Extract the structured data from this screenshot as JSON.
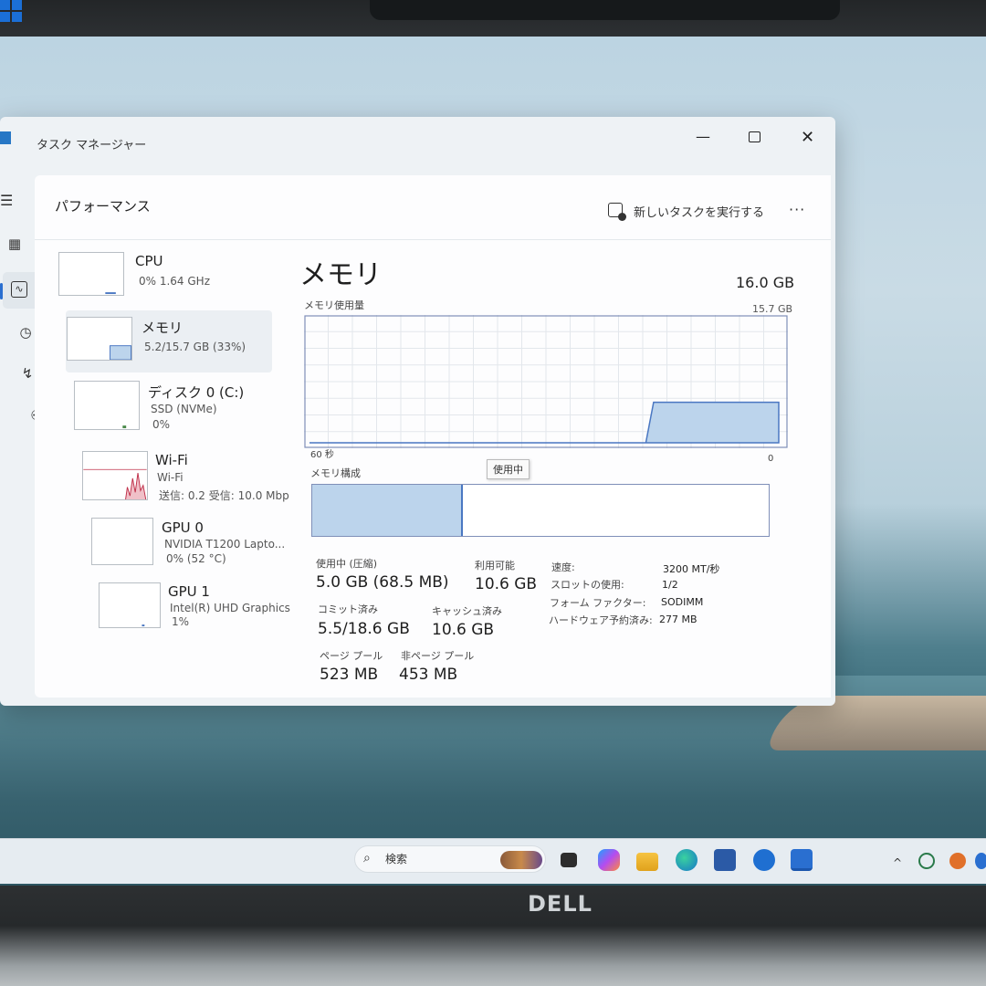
{
  "window": {
    "title": "タスク マネージャー",
    "page_title": "パフォーマンス",
    "run_task_label": "新しいタスクを実行する",
    "more_label": "···"
  },
  "nav": {
    "icons": [
      "hamburger-icon",
      "processes-icon",
      "performance-icon",
      "history-icon",
      "startup-icon",
      "users-icon",
      "details-icon",
      "services-icon",
      "settings-icon"
    ],
    "active": "performance-icon"
  },
  "devices": [
    {
      "name": "CPU",
      "sub1": "0% 1.64 GHz",
      "sub2": "",
      "sub3": ""
    },
    {
      "name": "メモリ",
      "sub1": "5.2/15.7 GB (33%)",
      "sub2": "",
      "sub3": ""
    },
    {
      "name": "ディスク 0 (C:)",
      "sub1": "SSD (NVMe)",
      "sub2": "0%",
      "sub3": ""
    },
    {
      "name": "Wi-Fi",
      "sub1": "Wi-Fi",
      "sub2": "送信: 0.2 受信: 10.0 Mbp",
      "sub3": ""
    },
    {
      "name": "GPU 0",
      "sub1": "NVIDIA T1200 Lapto...",
      "sub2": "0% (52 °C)",
      "sub3": ""
    },
    {
      "name": "GPU 1",
      "sub1": "Intel(R) UHD Graphics",
      "sub2": "1%",
      "sub3": ""
    }
  ],
  "memory": {
    "title": "メモリ",
    "total": "16.0 GB",
    "usage_label": "メモリ使用量",
    "usage_max": "15.7 GB",
    "axis_left": "60 秒",
    "axis_right": "0",
    "tooltip": "使用中",
    "composition_label": "メモリ構成",
    "composition_inuse_fraction": 0.33,
    "stats": {
      "in_use_label": "使用中 (圧縮)",
      "in_use_value": "5.0 GB (68.5 MB)",
      "available_label": "利用可能",
      "available_value": "10.6 GB",
      "committed_label": "コミット済み",
      "committed_value": "5.5/18.6 GB",
      "cached_label": "キャッシュ済み",
      "cached_value": "10.6 GB",
      "paged_label": "ページ プール",
      "paged_value": "523 MB",
      "nonpaged_label": "非ページ プール",
      "nonpaged_value": "453 MB"
    },
    "specs": {
      "speed_label": "速度:",
      "speed_value": "3200 MT/秒",
      "slots_label": "スロットの使用:",
      "slots_value": "1/2",
      "form_label": "フォーム ファクター:",
      "form_value": "SODIMM",
      "reserved_label": "ハードウェア予約済み:",
      "reserved_value": "277 MB"
    }
  },
  "chart_data": {
    "type": "area",
    "title": "メモリ使用量",
    "xlabel": "",
    "ylabel": "",
    "x": [
      60,
      17,
      16,
      0
    ],
    "x_unit": "秒",
    "xlim": [
      60,
      0
    ],
    "ylim": [
      0,
      15.7
    ],
    "y_unit": "GB",
    "series": [
      {
        "values": [
          0,
          0,
          5.2,
          5.2
        ]
      }
    ],
    "grid": true
  },
  "taskbar": {
    "search_label": "検索"
  },
  "brand": "DELL",
  "colors": {
    "accent": "#2a6fd0",
    "memory_fill": "#bcd4ec",
    "memory_line": "#4a77c2",
    "wifi_line": "#c0304a"
  }
}
